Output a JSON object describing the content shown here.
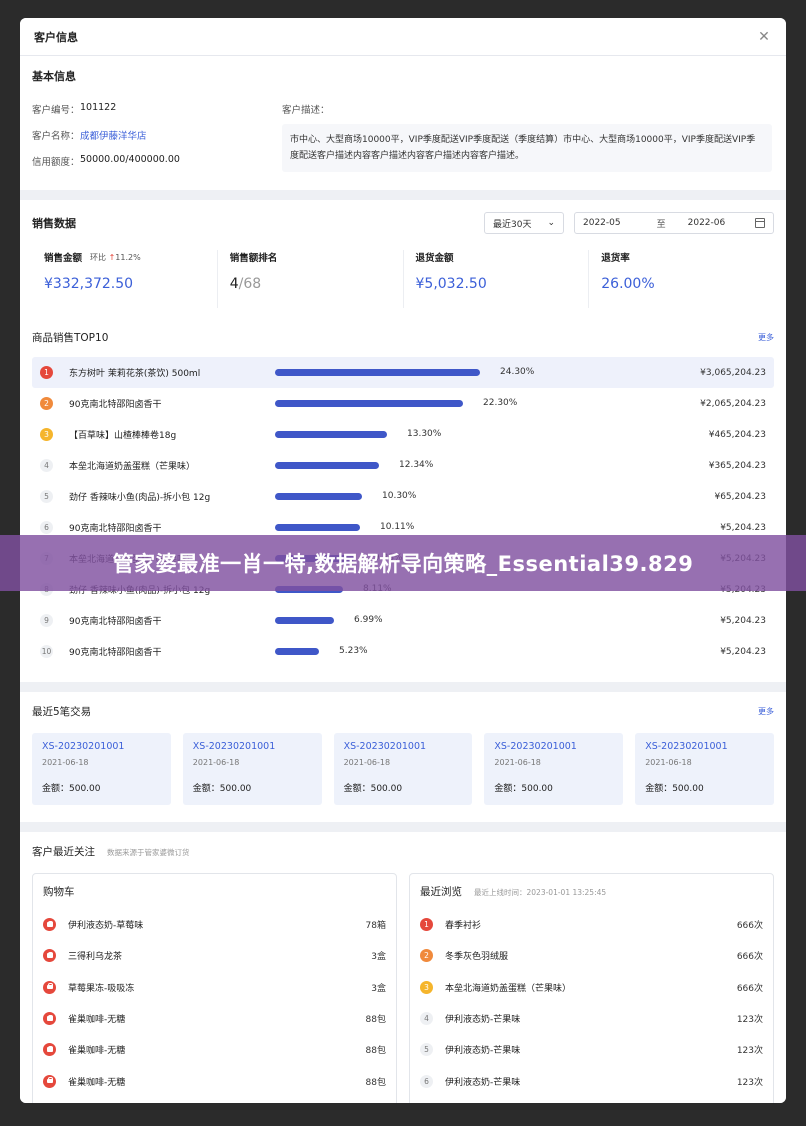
{
  "window": {
    "title": "客户信息"
  },
  "basic": {
    "title": "基本信息",
    "customer_no_label": "客户编号：",
    "customer_no": "101122",
    "customer_name_label": "客户名称：",
    "customer_name": "成都伊藤洋华店",
    "credit_label": "信用额度：",
    "credit": "50000.00/400000.00",
    "desc_label": "客户描述：",
    "desc": "市中心、大型商场10000平，VIP季度配送VIP季度配送（季度结算）市中心、大型商场10000平，VIP季度配送VIP季度配送客户描述内容客户描述内容客户描述内容客户描述。"
  },
  "sales": {
    "title": "销售数据",
    "range_select": "最近30天",
    "date_from": "2022-05",
    "date_sep": "至",
    "date_to": "2022-06",
    "stats": {
      "amount_label": "销售金额",
      "mom_label": "环比",
      "mom_value": "11.2%",
      "amount": "¥332,372.50",
      "rank_label": "销售额排名",
      "rank_value": "4",
      "rank_total": "/68",
      "refund_label": "退货金额",
      "refund": "¥5,032.50",
      "refund_rate_label": "退货率",
      "refund_rate": "26.00%"
    },
    "top10_title": "商品销售TOP10",
    "more": "更多",
    "top10": [
      {
        "rank": "1",
        "name": "东方树叶 茉莉花茶(茶饮) 500ml",
        "pct": "24.30%",
        "share": 24.3,
        "amount": "¥3,065,204.23"
      },
      {
        "rank": "2",
        "name": "90克南北特邵阳卤香干",
        "pct": "22.30%",
        "share": 22.3,
        "amount": "¥2,065,204.23"
      },
      {
        "rank": "3",
        "name": "【百草味】山楂棒棒卷18g",
        "pct": "13.30%",
        "share": 13.3,
        "amount": "¥465,204.23"
      },
      {
        "rank": "4",
        "name": "本垒北海道奶盖蛋糕（芒果味）",
        "pct": "12.34%",
        "share": 12.34,
        "amount": "¥365,204.23"
      },
      {
        "rank": "5",
        "name": "劲仔 香辣味小鱼(肉品)-拆小包 12g",
        "pct": "10.30%",
        "share": 10.3,
        "amount": "¥65,204.23"
      },
      {
        "rank": "6",
        "name": "90克南北特邵阳卤香干",
        "pct": "10.11%",
        "share": 10.11,
        "amount": "¥5,204.23"
      },
      {
        "rank": "7",
        "name": "本垒北海道奶盖蛋糕（芒果味）",
        "pct": "9.33%",
        "share": 9.33,
        "amount": "¥5,204.23"
      },
      {
        "rank": "8",
        "name": "劲仔 香辣味小鱼(肉品)-拆小包 12g",
        "pct": "8.11%",
        "share": 8.11,
        "amount": "¥5,204.23"
      },
      {
        "rank": "9",
        "name": "90克南北特邵阳卤香干",
        "pct": "6.99%",
        "share": 6.99,
        "amount": "¥5,204.23"
      },
      {
        "rank": "10",
        "name": "90克南北特邵阳卤香干",
        "pct": "5.23%",
        "share": 5.23,
        "amount": "¥5,204.23"
      }
    ]
  },
  "trades": {
    "title": "最近5笔交易",
    "more": "更多",
    "items": [
      {
        "id": "XS-20230201001",
        "date": "2021-06-18",
        "amount": "金额：500.00"
      },
      {
        "id": "XS-20230201001",
        "date": "2021-06-18",
        "amount": "金额：500.00"
      },
      {
        "id": "XS-20230201001",
        "date": "2021-06-18",
        "amount": "金额：500.00"
      },
      {
        "id": "XS-20230201001",
        "date": "2021-06-18",
        "amount": "金额：500.00"
      },
      {
        "id": "XS-20230201001",
        "date": "2021-06-18",
        "amount": "金额：500.00"
      }
    ]
  },
  "attention": {
    "title": "客户最近关注",
    "note": "数据来源于管家婆微订货",
    "cart": {
      "title": "购物车",
      "items": [
        {
          "name": "伊利液态奶-草莓味",
          "qty": "78箱"
        },
        {
          "name": "三得利乌龙茶",
          "qty": "3盒"
        },
        {
          "name": "草莓果冻-吸吸冻",
          "qty": "3盒"
        },
        {
          "name": "雀巢咖啡-无糖",
          "qty": "88包"
        },
        {
          "name": "雀巢咖啡-无糖",
          "qty": "88包"
        },
        {
          "name": "雀巢咖啡-无糖",
          "qty": "88包"
        }
      ]
    },
    "browse": {
      "title": "最近浏览",
      "note": "最近上线时间：2023-01-01 13:25:45",
      "items": [
        {
          "rank": "1",
          "name": "春季衬衫",
          "qty": "666次"
        },
        {
          "rank": "2",
          "name": "冬季灰色羽绒服",
          "qty": "666次"
        },
        {
          "rank": "3",
          "name": "本垒北海道奶盖蛋糕（芒果味）",
          "qty": "666次"
        },
        {
          "rank": "4",
          "name": "伊利液态奶-芒果味",
          "qty": "123次"
        },
        {
          "rank": "5",
          "name": "伊利液态奶-芒果味",
          "qty": "123次"
        },
        {
          "rank": "6",
          "name": "伊利液态奶-芒果味",
          "qty": "123次"
        }
      ]
    }
  },
  "overlay": {
    "text": "管家婆最准一肖一特,数据解析导向策略_Essential39.829"
  }
}
